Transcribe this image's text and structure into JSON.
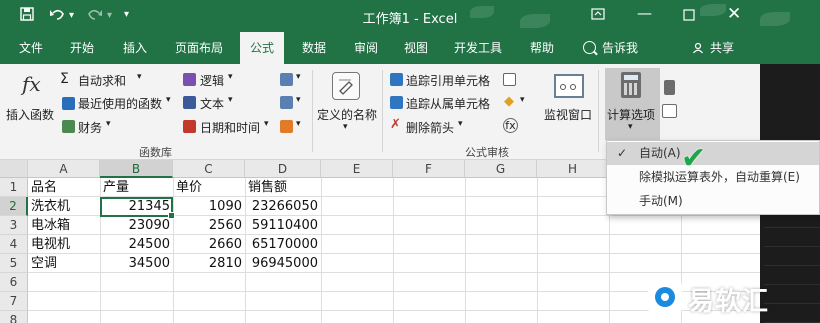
{
  "titlebar": {
    "title": "工作簿1 - Excel",
    "save_icon": "save-icon",
    "undo_icon": "undo-icon",
    "redo_icon": "redo-icon",
    "customize_icon": "customize-qat-icon",
    "window_controls": [
      "ribbon-display-options-icon",
      "minimize-icon",
      "restore-icon",
      "close-icon"
    ]
  },
  "tabs": {
    "items": [
      "文件",
      "开始",
      "插入",
      "页面布局",
      "公式",
      "数据",
      "审阅",
      "视图",
      "开发工具",
      "帮助"
    ],
    "active": "公式",
    "tell_me": "告诉我",
    "share": "共享"
  },
  "ribbon": {
    "insert_function": "插入函数",
    "autosum": "自动求和",
    "recently_used": "最近使用的函数",
    "financial": "财务",
    "logical": "逻辑",
    "text": "文本",
    "date_time": "日期和时间",
    "function_library": "函数库",
    "define_name": "定义的名称",
    "trace_precedents": "追踪引用单元格",
    "trace_dependents": "追踪从属单元格",
    "remove_arrows": "删除箭头",
    "formula_auditing": "公式审核",
    "watch_window": "监视窗口",
    "calc_options": "计算选项",
    "fx_symbol": "fx"
  },
  "sheet": {
    "columns": [
      "A",
      "B",
      "C",
      "D",
      "E",
      "F",
      "G",
      "H"
    ],
    "rows": [
      "1",
      "2",
      "3",
      "4",
      "5",
      "6",
      "7",
      "8"
    ],
    "active_cell": "B2",
    "data": [
      [
        "品名",
        "产量",
        "单价",
        "销售额"
      ],
      [
        "洗衣机",
        "21345",
        "1090",
        "23266050"
      ],
      [
        "电冰箱",
        "23090",
        "2560",
        "59110400"
      ],
      [
        "电视机",
        "24500",
        "2660",
        "65170000"
      ],
      [
        "空调",
        "34500",
        "2810",
        "96945000"
      ]
    ]
  },
  "calc_menu": {
    "items": [
      {
        "label": "自动(A)",
        "checked": true
      },
      {
        "label": "除模拟运算表外，自动重算(E)",
        "checked": false
      },
      {
        "label": "手动(M)",
        "checked": false
      }
    ],
    "check_mark": "✓"
  },
  "watermark": {
    "text": "易软汇"
  },
  "colors": {
    "excel_green": "#217346",
    "check_green": "#1fa64a"
  }
}
